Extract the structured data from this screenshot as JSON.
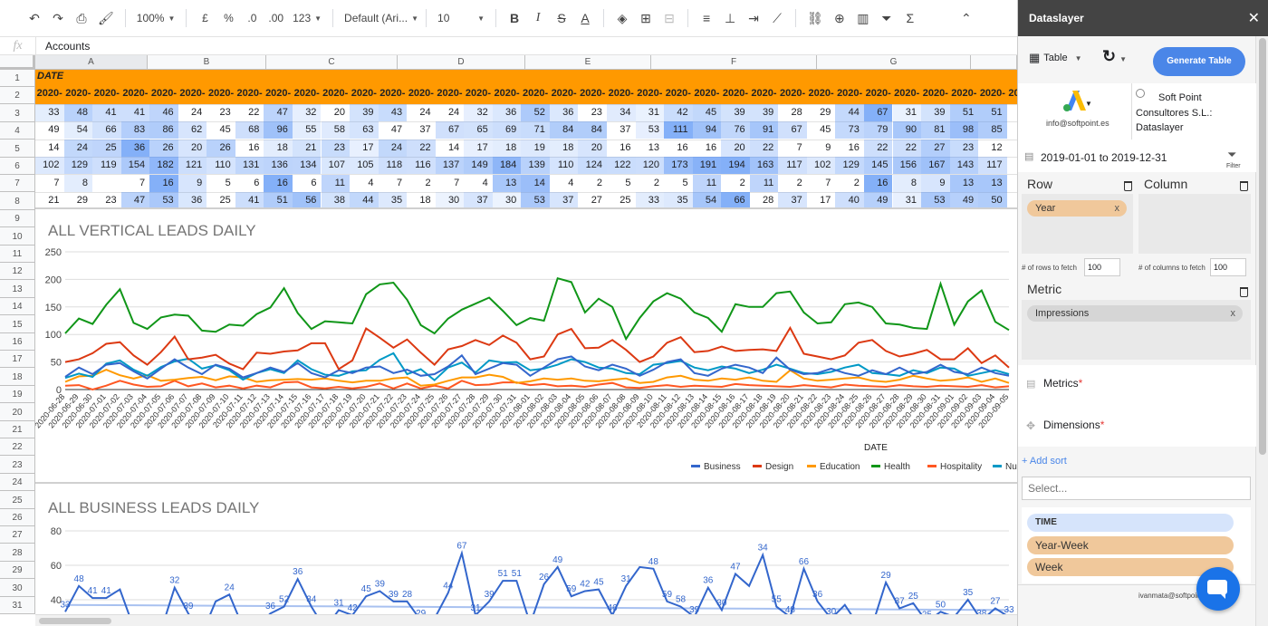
{
  "toolbar": {
    "zoom": "100%",
    "currency": "£",
    "percent": "%",
    "dec_less": ".0",
    "dec_more": ".00",
    "number_format": "123",
    "font": "Default (Ari...",
    "font_size": "10"
  },
  "formula_bar": {
    "fx": "fx",
    "value": "Accounts"
  },
  "columns": [
    "A",
    "B",
    "C",
    "D",
    "E",
    "F",
    "G"
  ],
  "rows": [
    "1",
    "2",
    "3",
    "4",
    "5",
    "6",
    "7",
    "8",
    "9",
    "10",
    "11",
    "12",
    "13",
    "14",
    "15",
    "16",
    "17",
    "18",
    "19",
    "20",
    "21",
    "22",
    "23",
    "24",
    "25",
    "26",
    "27",
    "28",
    "29",
    "30",
    "31"
  ],
  "table": {
    "header": "DATE",
    "year_label": "2020-",
    "data": [
      [
        33,
        48,
        41,
        41,
        46,
        24,
        23,
        22,
        47,
        32,
        20,
        39,
        43,
        24,
        24,
        32,
        36,
        52,
        36,
        23,
        34,
        31,
        42,
        45,
        39,
        39,
        28,
        29,
        44,
        67,
        31,
        39,
        51,
        51
      ],
      [
        49,
        54,
        66,
        83,
        86,
        62,
        45,
        68,
        96,
        55,
        58,
        63,
        47,
        37,
        67,
        65,
        69,
        71,
        84,
        84,
        37,
        53,
        111,
        94,
        76,
        91,
        67,
        45,
        73,
        79,
        90,
        81,
        98,
        85
      ],
      [
        14,
        24,
        25,
        36,
        26,
        20,
        26,
        16,
        18,
        21,
        23,
        17,
        24,
        22,
        14,
        17,
        18,
        19,
        18,
        20,
        16,
        13,
        16,
        16,
        20,
        22,
        7,
        9,
        16,
        22,
        22,
        27,
        23,
        12
      ],
      [
        102,
        129,
        119,
        154,
        182,
        121,
        110,
        131,
        136,
        134,
        107,
        105,
        118,
        116,
        137,
        149,
        184,
        139,
        110,
        124,
        122,
        120,
        173,
        191,
        194,
        163,
        117,
        102,
        129,
        145,
        156,
        167,
        143,
        117
      ],
      [
        7,
        8,
        "",
        7,
        16,
        9,
        5,
        6,
        16,
        6,
        11,
        4,
        7,
        2,
        7,
        4,
        13,
        14,
        4,
        2,
        5,
        2,
        5,
        11,
        2,
        11,
        2,
        7,
        2,
        16,
        8,
        9,
        13,
        13
      ],
      [
        21,
        29,
        23,
        47,
        53,
        36,
        25,
        41,
        51,
        56,
        38,
        44,
        35,
        18,
        30,
        37,
        30,
        53,
        37,
        27,
        25,
        33,
        35,
        54,
        66,
        28,
        37,
        17,
        40,
        49,
        31,
        53,
        49,
        50
      ]
    ]
  },
  "chart1": {
    "title": "ALL VERTICAL LEADS DAILY",
    "xlabel": "DATE",
    "yticks": [
      "250",
      "200",
      "150",
      "100",
      "50",
      "0"
    ],
    "dates": [
      "2020-06-28",
      "2020-06-29",
      "2020-06-30",
      "2020-07-01",
      "2020-07-02",
      "2020-07-03",
      "2020-07-04",
      "2020-07-05",
      "2020-07-06",
      "2020-07-07",
      "2020-07-08",
      "2020-07-09",
      "2020-07-10",
      "2020-07-11",
      "2020-07-12",
      "2020-07-13",
      "2020-07-14",
      "2020-07-15",
      "2020-07-16",
      "2020-07-17",
      "2020-07-18",
      "2020-07-19",
      "2020-07-20",
      "2020-07-21",
      "2020-07-22",
      "2020-07-23",
      "2020-07-24",
      "2020-07-25",
      "2020-07-26",
      "2020-07-27",
      "2020-07-28",
      "2020-07-29",
      "2020-07-30",
      "2020-07-31",
      "2020-08-01",
      "2020-08-02",
      "2020-08-03",
      "2020-08-04",
      "2020-08-05",
      "2020-08-06",
      "2020-08-07",
      "2020-08-08",
      "2020-08-09",
      "2020-08-10",
      "2020-08-11",
      "2020-08-12",
      "2020-08-13",
      "2020-08-14",
      "2020-08-15",
      "2020-08-16",
      "2020-08-17",
      "2020-08-18",
      "2020-08-19",
      "2020-08-20",
      "2020-08-21",
      "2020-08-22",
      "2020-08-23",
      "2020-08-24",
      "2020-08-25",
      "2020-08-26",
      "2020-08-27",
      "2020-08-28",
      "2020-08-29",
      "2020-08-30",
      "2020-08-31",
      "2020-09-01",
      "2020-09-02",
      "2020-09-03",
      "2020-09-04",
      "2020-09-05"
    ],
    "legend": [
      {
        "name": "Business",
        "color": "#3366cc"
      },
      {
        "name": "Design",
        "color": "#dc3912"
      },
      {
        "name": "Education",
        "color": "#ff9900"
      },
      {
        "name": "Health",
        "color": "#109618"
      },
      {
        "name": "Hospitality",
        "color": "#ff5722"
      },
      {
        "name": "Nu",
        "color": "#0099c6"
      }
    ]
  },
  "chart2": {
    "title": "ALL BUSINESS LEADS DAILY",
    "yticks": [
      "80",
      "60",
      "40"
    ],
    "labels": [
      "33",
      "48",
      "41",
      "41",
      "46",
      "24",
      "47",
      "32",
      "39",
      "43",
      "24",
      "24",
      "32",
      "36",
      "52",
      "36",
      "34",
      "31",
      "42",
      "45",
      "39",
      "39",
      "28",
      "29",
      "44",
      "67",
      "31",
      "39",
      "51",
      "51",
      "26",
      "49",
      "59",
      "42",
      "45",
      "46",
      "31",
      "48",
      "59",
      "58",
      "39",
      "36",
      "30",
      "47",
      "34",
      "55",
      "48",
      "66",
      "36",
      "30",
      "58",
      "39",
      "29",
      "37",
      "25",
      "25",
      "50",
      "35",
      "38",
      "27",
      "33"
    ]
  },
  "chart_data": [
    {
      "type": "line",
      "title": "ALL VERTICAL LEADS DAILY",
      "xlabel": "DATE",
      "ylim": [
        0,
        250
      ],
      "series": [
        {
          "name": "Business",
          "values": [
            23,
            40,
            28,
            45,
            48,
            33,
            20,
            38,
            55,
            40,
            28,
            45,
            38,
            22,
            30,
            40,
            32,
            48,
            30,
            22,
            35,
            30,
            40,
            42,
            30,
            36,
            25,
            28,
            42,
            62,
            28,
            38,
            48,
            45,
            25,
            40,
            55,
            60,
            42,
            35,
            45,
            38,
            25,
            36,
            50,
            55,
            30,
            25,
            38,
            45,
            40,
            30,
            58,
            36,
            28,
            30,
            38,
            30,
            25,
            35,
            28,
            40,
            28,
            32,
            45,
            32,
            28,
            40,
            30,
            25
          ]
        },
        {
          "name": "Design",
          "values": [
            50,
            55,
            66,
            83,
            86,
            62,
            45,
            68,
            96,
            55,
            58,
            63,
            47,
            37,
            67,
            65,
            69,
            71,
            84,
            84,
            37,
            53,
            111,
            94,
            76,
            91,
            67,
            45,
            73,
            79,
            90,
            81,
            98,
            85,
            55,
            60,
            100,
            110,
            75,
            76,
            90,
            72,
            50,
            60,
            85,
            95,
            68,
            70,
            78,
            70,
            72,
            73,
            70,
            112,
            65,
            60,
            55,
            62,
            85,
            90,
            70,
            60,
            65,
            72,
            55,
            55,
            75,
            48,
            62,
            40
          ]
        },
        {
          "name": "Education",
          "values": [
            14,
            24,
            25,
            36,
            26,
            20,
            26,
            16,
            18,
            21,
            23,
            17,
            24,
            22,
            14,
            17,
            18,
            19,
            18,
            20,
            16,
            13,
            16,
            16,
            20,
            22,
            7,
            9,
            16,
            22,
            22,
            27,
            23,
            12,
            15,
            20,
            18,
            20,
            16,
            15,
            18,
            20,
            12,
            14,
            22,
            25,
            18,
            16,
            20,
            18,
            22,
            16,
            14,
            35,
            20,
            16,
            18,
            20,
            22,
            16,
            14,
            18,
            25,
            20,
            16,
            18,
            22,
            14,
            20,
            12
          ]
        },
        {
          "name": "Health",
          "values": [
            102,
            129,
            119,
            154,
            182,
            121,
            110,
            131,
            136,
            134,
            107,
            105,
            118,
            116,
            137,
            149,
            184,
            139,
            110,
            124,
            122,
            120,
            173,
            191,
            194,
            163,
            117,
            102,
            129,
            145,
            156,
            167,
            143,
            117,
            130,
            125,
            202,
            195,
            140,
            165,
            150,
            92,
            130,
            160,
            175,
            165,
            140,
            130,
            105,
            155,
            150,
            150,
            175,
            178,
            140,
            120,
            122,
            155,
            158,
            150,
            120,
            118,
            112,
            110,
            192,
            118,
            160,
            180,
            123,
            108
          ]
        },
        {
          "name": "Hospitality",
          "values": [
            7,
            8,
            0,
            7,
            16,
            9,
            5,
            6,
            16,
            6,
            11,
            4,
            7,
            2,
            7,
            4,
            13,
            14,
            4,
            2,
            5,
            2,
            5,
            11,
            2,
            11,
            2,
            7,
            2,
            16,
            8,
            9,
            13,
            13,
            8,
            10,
            6,
            7,
            5,
            9,
            12,
            4,
            3,
            6,
            8,
            5,
            7,
            6,
            5,
            10,
            8,
            7,
            6,
            5,
            8,
            6,
            4,
            9,
            7,
            6,
            5,
            8,
            6,
            5,
            7,
            6,
            5,
            8,
            4,
            6
          ]
        },
        {
          "name": "Nu",
          "values": [
            21,
            29,
            23,
            47,
            53,
            36,
            25,
            41,
            51,
            56,
            38,
            44,
            35,
            18,
            30,
            37,
            30,
            53,
            37,
            27,
            25,
            33,
            35,
            54,
            66,
            28,
            37,
            17,
            40,
            49,
            31,
            53,
            49,
            50,
            35,
            38,
            45,
            55,
            50,
            40,
            38,
            30,
            28,
            45,
            48,
            52,
            40,
            35,
            42,
            38,
            30,
            36,
            45,
            38,
            30,
            28,
            32,
            40,
            45,
            30,
            28,
            25,
            35,
            30,
            40,
            38,
            25,
            30,
            35,
            28
          ]
        }
      ]
    },
    {
      "type": "line",
      "title": "ALL BUSINESS LEADS DAILY",
      "ylim": [
        20,
        80
      ],
      "series": [
        {
          "values": [
            33,
            48,
            41,
            41,
            46,
            24,
            23,
            22,
            47,
            32,
            20,
            39,
            43,
            24,
            24,
            32,
            36,
            52,
            36,
            23,
            34,
            31,
            42,
            45,
            39,
            39,
            28,
            29,
            44,
            67,
            31,
            39,
            51,
            51,
            26,
            49,
            59,
            42,
            45,
            46,
            31,
            48,
            59,
            58,
            39,
            36,
            30,
            47,
            34,
            55,
            48,
            66,
            36,
            30,
            58,
            39,
            29,
            37,
            25,
            25,
            50,
            35,
            38,
            27,
            33,
            30,
            40,
            28,
            35,
            30
          ]
        }
      ]
    }
  ],
  "panel": {
    "title": "Dataslayer",
    "view": "Table",
    "generate": "Generate Table",
    "account_email": "info@softpoint.es",
    "company": [
      "Soft Point",
      "Consultores S.L.:",
      "Dataslayer"
    ],
    "date_range": "2019-01-01 to 2019-12-31",
    "filter": "Filter",
    "row_label": "Row",
    "column_label": "Column",
    "row_dim": "Year",
    "rows_fetch_label": "# of rows to fetch",
    "rows_fetch": "100",
    "cols_fetch_label": "# of columns to fetch",
    "cols_fetch": "100",
    "metric_label": "Metric",
    "metric": "Impressions",
    "metrics": "Metrics",
    "dimensions": "Dimensions",
    "add_sort": "+ Add sort",
    "select_placeholder": "Select...",
    "list": [
      "TIME",
      "Year-Week",
      "Week"
    ],
    "footer_email": "ivanmata@softpoint.es"
  },
  "colors": {
    "orange": "#ff9900",
    "blue": "#4a86e8",
    "panel_header": "#444444"
  }
}
